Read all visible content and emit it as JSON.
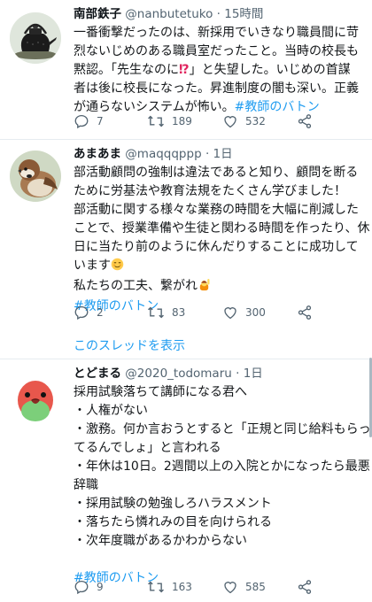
{
  "tweets": [
    {
      "name": "南部鉄子",
      "handle": "@nanbutetuko",
      "sep": "·",
      "time": "15時間",
      "lines": [
        "一番衝撃だったのは、新採用でいきなり職員間に苛",
        "烈ないじめのある職員室だったこと。当時の校長も",
        "黙認。「先生なのに",
        "」と失望した。いじめの首謀",
        "者は後に校長になった。昇進制度の闇も深い。正義",
        "が通らないシステムが怖い。"
      ],
      "inline_emoji": "⁉",
      "hashtag": "#教師のバトン",
      "replies": "7",
      "retweets": "189",
      "likes": "532"
    },
    {
      "name": "あまあま",
      "handle": "@maqqqppp",
      "sep": "·",
      "time": "1日",
      "lines": [
        "部活動顧問の強制は違法であると知り、顧問を断る",
        "ために労基法や教育法規をたくさん学びました！",
        "部活動に関する様々な業務の時間を大幅に削減した",
        "ことで、授業準備や生徒と関わる時間を作ったり、休",
        "日に当たり前のように休んだりすることに成功して",
        "います",
        "私たちの工夫、繋がれ"
      ],
      "hashtag": "#教師のバトン",
      "replies": "2",
      "retweets": "83",
      "likes": "300",
      "thread_link": "このスレッドを表示"
    },
    {
      "name": "とどまる",
      "handle": "@2020_todomaru",
      "sep": "·",
      "time": "1日",
      "lines": [
        "採用試験落ちて講師になる君へ",
        "・人権がない",
        "・激務。何か言おうとすると「正規と同じ給料もらっ",
        "てるんでしょ」と言われる",
        "・年休は10日。2週間以上の入院とかになったら最悪",
        "辞職",
        "・採用試験の勉強しろハラスメント",
        "・落ちたら憐れみの目を向けられる",
        "・次年度職があるかわからない"
      ],
      "hashtag": "#教師のバトン",
      "replies": "9",
      "retweets": "163",
      "likes": "585"
    }
  ],
  "colors": {
    "link": "#1d9bf0",
    "muted": "#536471",
    "divider": "#e6ecf0"
  }
}
